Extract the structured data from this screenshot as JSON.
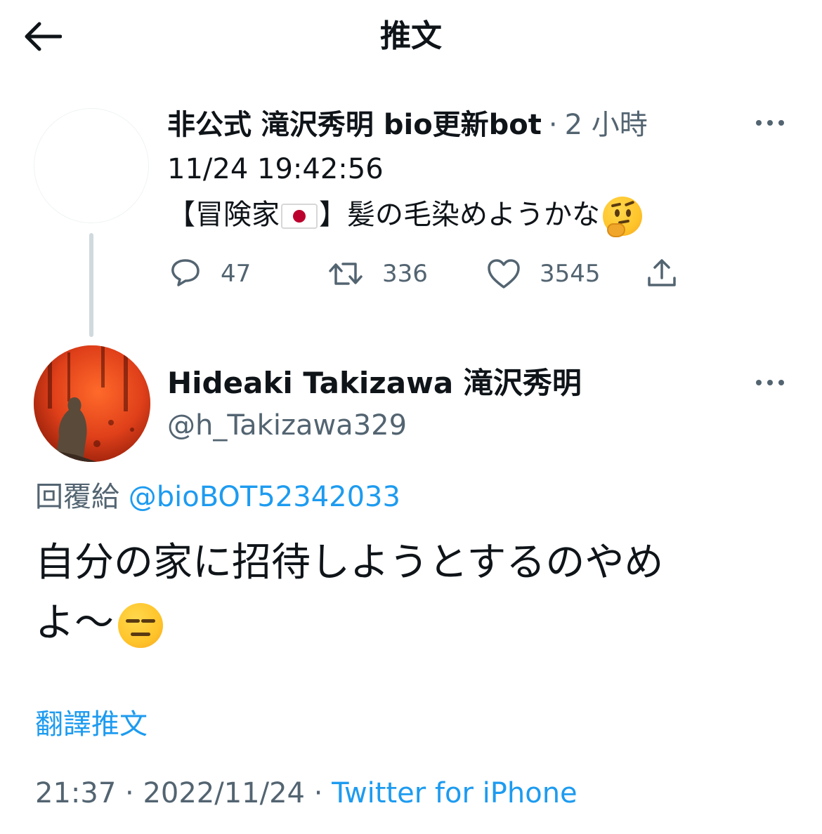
{
  "header": {
    "title": "推文",
    "back_icon": "arrow-left-icon"
  },
  "parent_tweet": {
    "author_name": "非公式 滝沢秀明 bio更新bot",
    "separator": "·",
    "relative_time": "2 小時",
    "line1": "11/24 19:42:56",
    "line2_before_flag": "【冒険家",
    "line2_after_flag": "】髪の毛染めようかな",
    "emoji_names": [
      "japan-flag-icon",
      "thinking-face-icon"
    ],
    "stats": {
      "replies": "47",
      "retweets": "336",
      "likes": "3545"
    },
    "icons": [
      "reply-icon",
      "retweet-icon",
      "like-icon",
      "share-icon"
    ]
  },
  "main_tweet": {
    "author_name": "Hideaki Takizawa 滝沢秀明",
    "handle": "@h_Takizawa329",
    "reply_prefix": "回覆給",
    "reply_mention": "@bioBOT52342033",
    "text_line1": "自分の家に招待しようとするのやめ",
    "text_line2": "よ～",
    "emoji_name": "expressionless-face-icon",
    "translate_label": "翻譯推文",
    "time": "21:37",
    "separator1": "·",
    "date": "2022/11/24",
    "separator2": "·",
    "source": "Twitter for iPhone"
  },
  "colors": {
    "text_primary": "#0f1419",
    "text_secondary": "#536471",
    "link": "#1d9bf0",
    "thread_line": "#cfd9de"
  }
}
